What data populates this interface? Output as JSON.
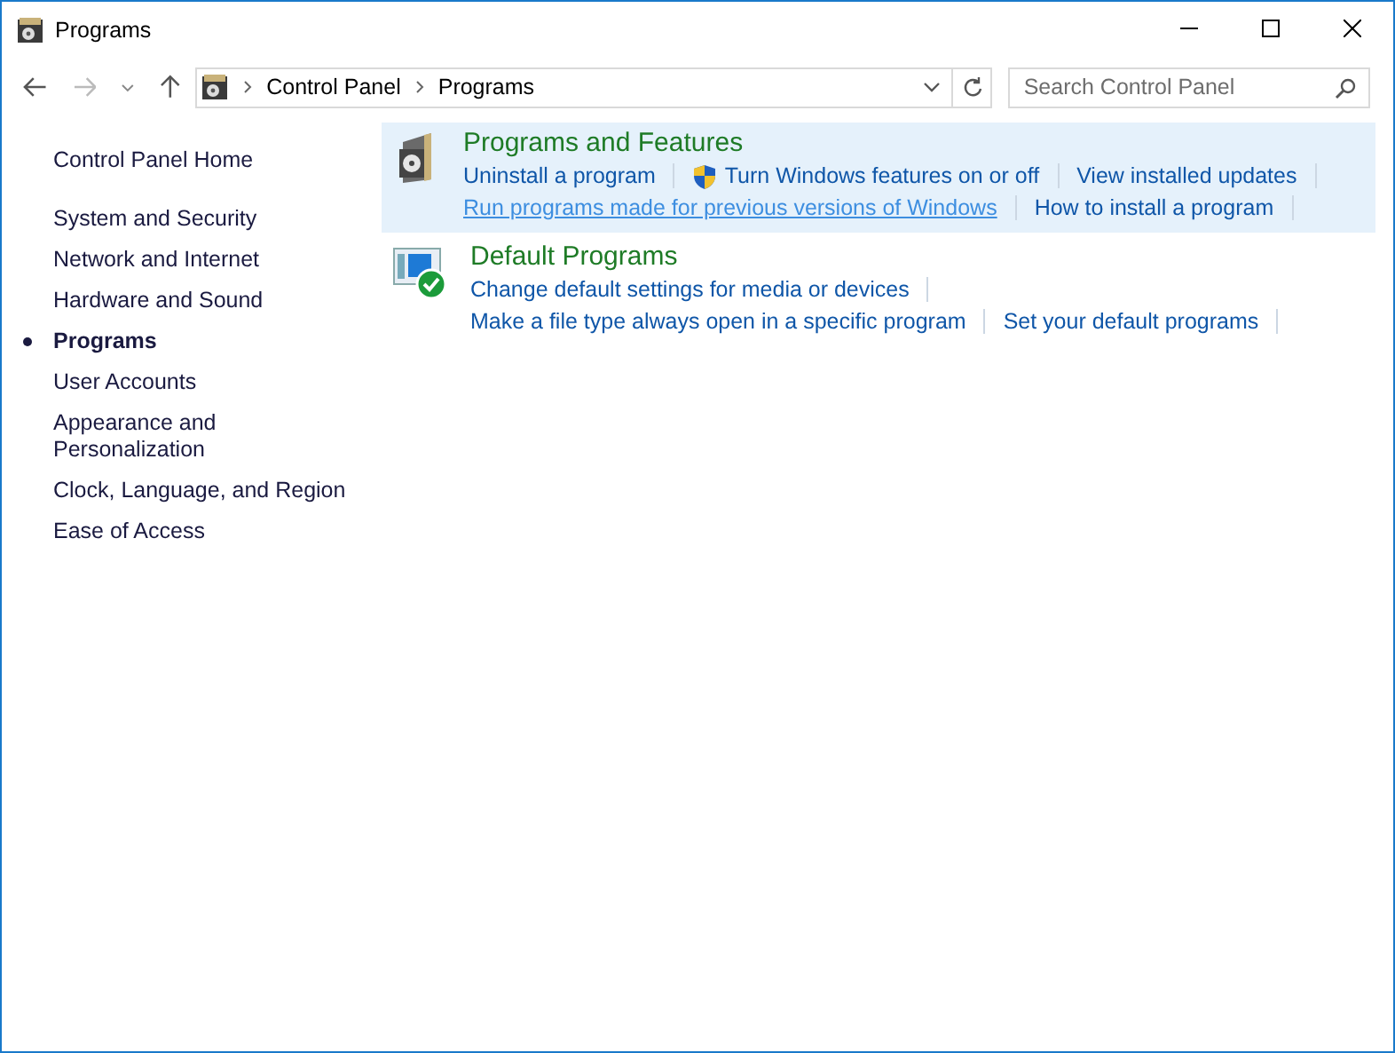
{
  "window": {
    "title": "Programs"
  },
  "address_bar": {
    "breadcrumbs": [
      "Control Panel",
      "Programs"
    ]
  },
  "search": {
    "placeholder": "Search Control Panel"
  },
  "sidebar": {
    "home": "Control Panel Home",
    "items": [
      {
        "label": "System and Security",
        "selected": false
      },
      {
        "label": "Network and Internet",
        "selected": false
      },
      {
        "label": "Hardware and Sound",
        "selected": false
      },
      {
        "label": "Programs",
        "selected": true
      },
      {
        "label": "User Accounts",
        "selected": false
      },
      {
        "label": "Appearance and Personalization",
        "selected": false
      },
      {
        "label": "Clock, Language, and Region",
        "selected": false
      },
      {
        "label": "Ease of Access",
        "selected": false
      }
    ]
  },
  "categories": [
    {
      "kind": "features",
      "title": "Programs and Features",
      "highlighted": true,
      "link_rows": [
        [
          {
            "text": "Uninstall a program",
            "shield": false,
            "hovered": false
          },
          {
            "text": "Turn Windows features on or off",
            "shield": true,
            "hovered": false
          },
          {
            "text": "View installed updates",
            "shield": false,
            "hovered": false
          }
        ],
        [
          {
            "text": "Run programs made for previous versions of Windows",
            "shield": false,
            "hovered": true
          },
          {
            "text": "How to install a program",
            "shield": false,
            "hovered": false
          }
        ]
      ]
    },
    {
      "kind": "defaults",
      "title": "Default Programs",
      "highlighted": false,
      "link_rows": [
        [
          {
            "text": "Change default settings for media or devices",
            "shield": false,
            "hovered": false
          }
        ],
        [
          {
            "text": "Make a file type always open in a specific program",
            "shield": false,
            "hovered": false
          },
          {
            "text": "Set your default programs",
            "shield": false,
            "hovered": false
          }
        ]
      ]
    }
  ]
}
